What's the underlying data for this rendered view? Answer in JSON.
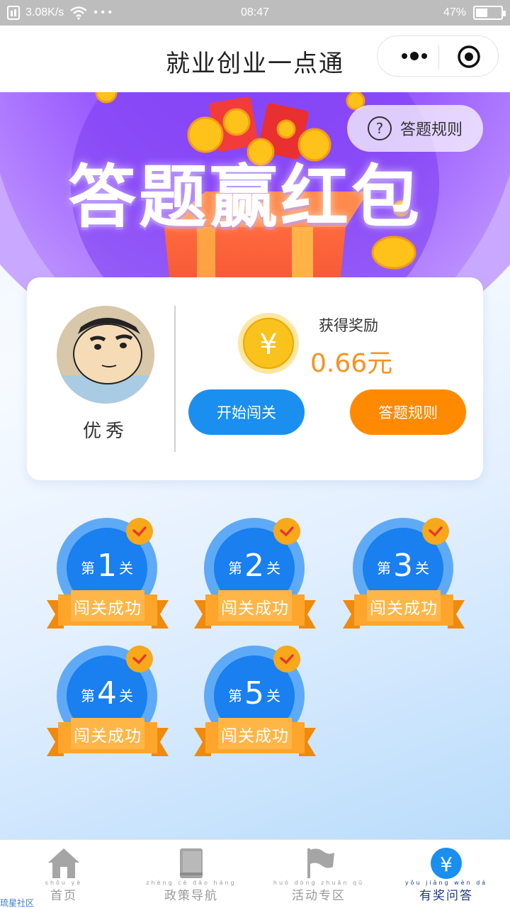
{
  "status_bar": {
    "speed": "3.08K/s",
    "dots": "• • •",
    "time": "08:47",
    "battery": "47%",
    "battery_level": 0.47
  },
  "header": {
    "title": "就业创业一点通"
  },
  "banner": {
    "title": "答题赢红包",
    "rules_label": "答题规则",
    "rules_icon": "question-circle-icon"
  },
  "profile": {
    "username": "优秀",
    "reward_label": "获得奖励",
    "reward_value": "0.66元",
    "coin_symbol": "¥"
  },
  "actions": {
    "start_label": "开始闯关",
    "rules_label": "答题规则"
  },
  "levels": [
    {
      "prefix": "第",
      "number": "1",
      "suffix": "关",
      "status": "闯关成功"
    },
    {
      "prefix": "第",
      "number": "2",
      "suffix": "关",
      "status": "闯关成功"
    },
    {
      "prefix": "第",
      "number": "3",
      "suffix": "关",
      "status": "闯关成功"
    },
    {
      "prefix": "第",
      "number": "4",
      "suffix": "关",
      "status": "闯关成功"
    },
    {
      "prefix": "第",
      "number": "5",
      "suffix": "关",
      "status": "闯关成功"
    }
  ],
  "tabbar": {
    "items": [
      {
        "pinyin": "shǒu yè",
        "label": "首页",
        "icon": "home-icon"
      },
      {
        "pinyin": "zhèng cè dǎo háng",
        "label": "政策导航",
        "icon": "book-icon"
      },
      {
        "pinyin": "huó dòng zhuān qū",
        "label": "活动专区",
        "icon": "flag-icon"
      },
      {
        "pinyin": "yǒu jiǎng wèn dá",
        "label": "有奖问答",
        "icon": "yuan-icon"
      }
    ],
    "active_index": 3
  },
  "watermark": "琉星社区",
  "colors": {
    "primary_blue": "#1a8ff0",
    "accent_orange": "#ff8a00",
    "reward_orange": "#f7931e",
    "active_tab": "#1e3a8a"
  }
}
